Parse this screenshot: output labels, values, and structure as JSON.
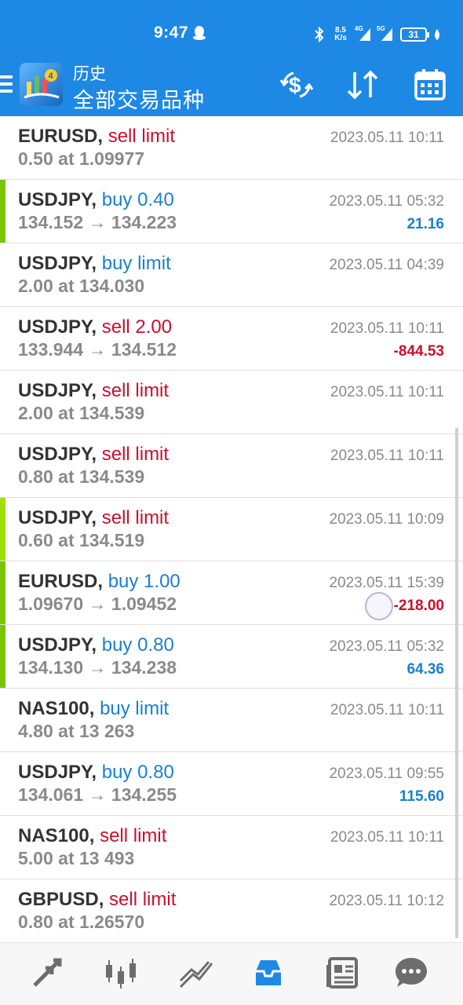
{
  "status_bar": {
    "time": "9:47",
    "speed_value": "8.5",
    "speed_unit": "K/s",
    "signal1_tag": "4G",
    "signal2_tag": "5G",
    "battery": "31",
    "icons": [
      "qq-icon",
      "bluetooth-icon",
      "signal-icon",
      "battery-icon",
      "leaf-icon"
    ]
  },
  "app_bar": {
    "title": "历史",
    "subtitle": "全部交易品种",
    "icons": [
      "menu-icon",
      "app-logo",
      "exchange-icon",
      "sort-icon",
      "calendar-icon"
    ]
  },
  "colors": {
    "primary": "#1e88e5",
    "sell": "#c8102e",
    "buy": "#1a7fd0",
    "marker": "#7cc400",
    "marker_light": "#9fe000"
  },
  "orders": [
    {
      "symbol": "EURUSD",
      "action": "sell limit",
      "side": "sell",
      "details": "0.50 at 1.09977",
      "datetime": "2023.05.11 10:11",
      "profit": "",
      "profit_sign": "",
      "marker": ""
    },
    {
      "symbol": "USDJPY",
      "action": "buy 0.40",
      "side": "buy",
      "details": "134.152 → 134.223",
      "datetime": "2023.05.11 05:32",
      "profit": "21.16",
      "profit_sign": "pos",
      "marker": "green"
    },
    {
      "symbol": "USDJPY",
      "action": "buy limit",
      "side": "buy",
      "details": "2.00 at 134.030",
      "datetime": "2023.05.11 04:39",
      "profit": "",
      "profit_sign": "",
      "marker": ""
    },
    {
      "symbol": "USDJPY",
      "action": "sell 2.00",
      "side": "sell",
      "details": "133.944 → 134.512",
      "datetime": "2023.05.11 10:11",
      "profit": "-844.53",
      "profit_sign": "neg",
      "marker": ""
    },
    {
      "symbol": "USDJPY",
      "action": "sell limit",
      "side": "sell",
      "details": "2.00 at 134.539",
      "datetime": "2023.05.11 10:11",
      "profit": "",
      "profit_sign": "",
      "marker": ""
    },
    {
      "symbol": "USDJPY",
      "action": "sell limit",
      "side": "sell",
      "details": "0.80 at 134.539",
      "datetime": "2023.05.11 10:11",
      "profit": "",
      "profit_sign": "",
      "marker": ""
    },
    {
      "symbol": "USDJPY",
      "action": "sell limit",
      "side": "sell",
      "details": "0.60 at 134.519",
      "datetime": "2023.05.11 10:09",
      "profit": "",
      "profit_sign": "",
      "marker": "light"
    },
    {
      "symbol": "EURUSD",
      "action": "buy 1.00",
      "side": "buy",
      "details": "1.09670 → 1.09452",
      "datetime": "2023.05.11 15:39",
      "profit": "-218.00",
      "profit_sign": "neg",
      "marker": "green"
    },
    {
      "symbol": "USDJPY",
      "action": "buy 0.80",
      "side": "buy",
      "details": "134.130 → 134.238",
      "datetime": "2023.05.11 05:32",
      "profit": "64.36",
      "profit_sign": "pos",
      "marker": "green"
    },
    {
      "symbol": "NAS100",
      "action": "buy limit",
      "side": "buy",
      "details": "4.80 at 13 263",
      "datetime": "2023.05.11 10:11",
      "profit": "",
      "profit_sign": "",
      "marker": ""
    },
    {
      "symbol": "USDJPY",
      "action": "buy 0.80",
      "side": "buy",
      "details": "134.061 → 134.255",
      "datetime": "2023.05.11 09:55",
      "profit": "115.60",
      "profit_sign": "pos",
      "marker": ""
    },
    {
      "symbol": "NAS100",
      "action": "sell limit",
      "side": "sell",
      "details": "5.00 at 13 493",
      "datetime": "2023.05.11 10:11",
      "profit": "",
      "profit_sign": "",
      "marker": ""
    },
    {
      "symbol": "GBPUSD",
      "action": "sell limit",
      "side": "sell",
      "details": "0.80 at 1.26570",
      "datetime": "2023.05.11 10:12",
      "profit": "",
      "profit_sign": "",
      "marker": ""
    }
  ],
  "bottom_nav": {
    "items": [
      "trade-icon",
      "quotes-chart-icon",
      "chart-icon",
      "history-icon",
      "news-icon",
      "messages-icon"
    ],
    "active": "history-icon"
  }
}
